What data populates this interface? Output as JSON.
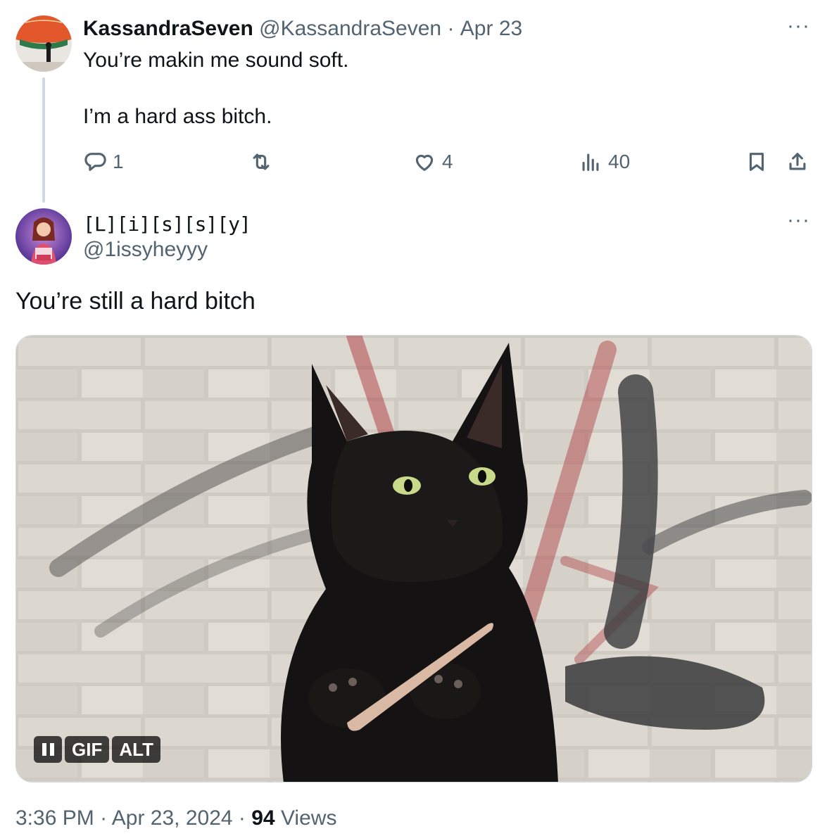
{
  "tweet1": {
    "display_name": "KassandraSeven",
    "handle": "@KassandraSeven",
    "separator": "·",
    "date": "Apr 23",
    "text_line1": "You’re makin me sound soft.",
    "text_line2": "I’m a hard ass bitch.",
    "reply_count": "1",
    "like_count": "4",
    "view_count": "40",
    "more_label": "···"
  },
  "tweet2": {
    "display_name": "[L][i][s][s][y]",
    "handle": "@1issyheyyy",
    "more_label": "···",
    "text": "You’re still a hard bitch",
    "media_badges": {
      "gif": "GIF",
      "alt": "ALT"
    },
    "footer": {
      "time": "3:36 PM",
      "sep1": "·",
      "date": "Apr 23, 2024",
      "sep2": "·",
      "views_count": "94",
      "views_label": "Views"
    }
  },
  "icons": {
    "reply": "reply-icon",
    "retweet": "retweet-icon",
    "like": "heart-icon",
    "views": "views-icon",
    "bookmark": "bookmark-icon",
    "share": "share-icon",
    "pause": "pause-icon"
  },
  "colors": {
    "text_primary": "#0f1419",
    "text_secondary": "#536471",
    "border": "#cfd9de"
  }
}
